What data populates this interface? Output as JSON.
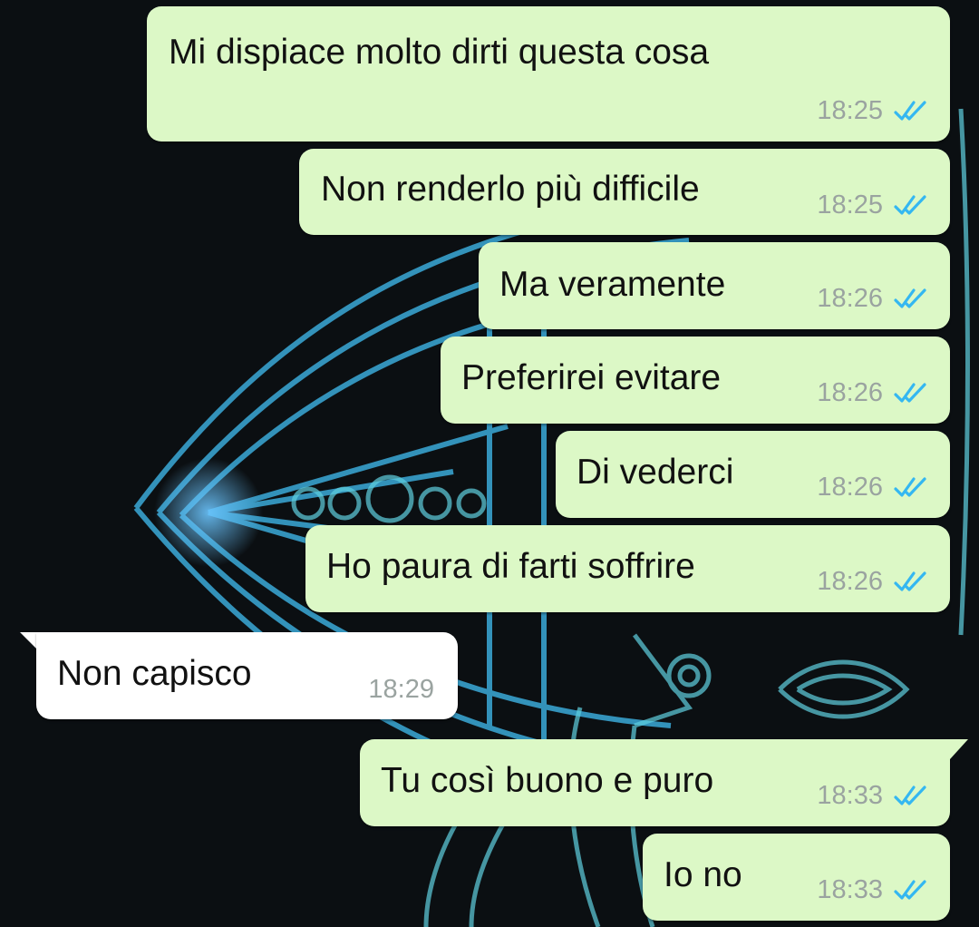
{
  "colors": {
    "outgoing_bubble": "#dcf8c6",
    "incoming_bubble": "#ffffff",
    "read_ticks": "#34b7f1",
    "time_text": "#9aa3a0"
  },
  "icons": {
    "read_receipt": "double-check-icon"
  },
  "messages": [
    {
      "text": "Mi dispiace molto dirti questa cosa",
      "time": "18:25",
      "direction": "outgoing",
      "read": true
    },
    {
      "text": "Non renderlo più difficile",
      "time": "18:25",
      "direction": "outgoing",
      "read": true
    },
    {
      "text": "Ma veramente",
      "time": "18:26",
      "direction": "outgoing",
      "read": true
    },
    {
      "text": "Preferirei evitare",
      "time": "18:26",
      "direction": "outgoing",
      "read": true
    },
    {
      "text": "Di vederci",
      "time": "18:26",
      "direction": "outgoing",
      "read": true
    },
    {
      "text": "Ho paura di farti soffrire",
      "time": "18:26",
      "direction": "outgoing",
      "read": true
    },
    {
      "text": "Non capisco",
      "time": "18:29",
      "direction": "incoming",
      "read": false
    },
    {
      "text": "Tu così buono e puro",
      "time": "18:33",
      "direction": "outgoing",
      "read": true
    },
    {
      "text": "Io no",
      "time": "18:33",
      "direction": "outgoing",
      "read": true
    }
  ]
}
